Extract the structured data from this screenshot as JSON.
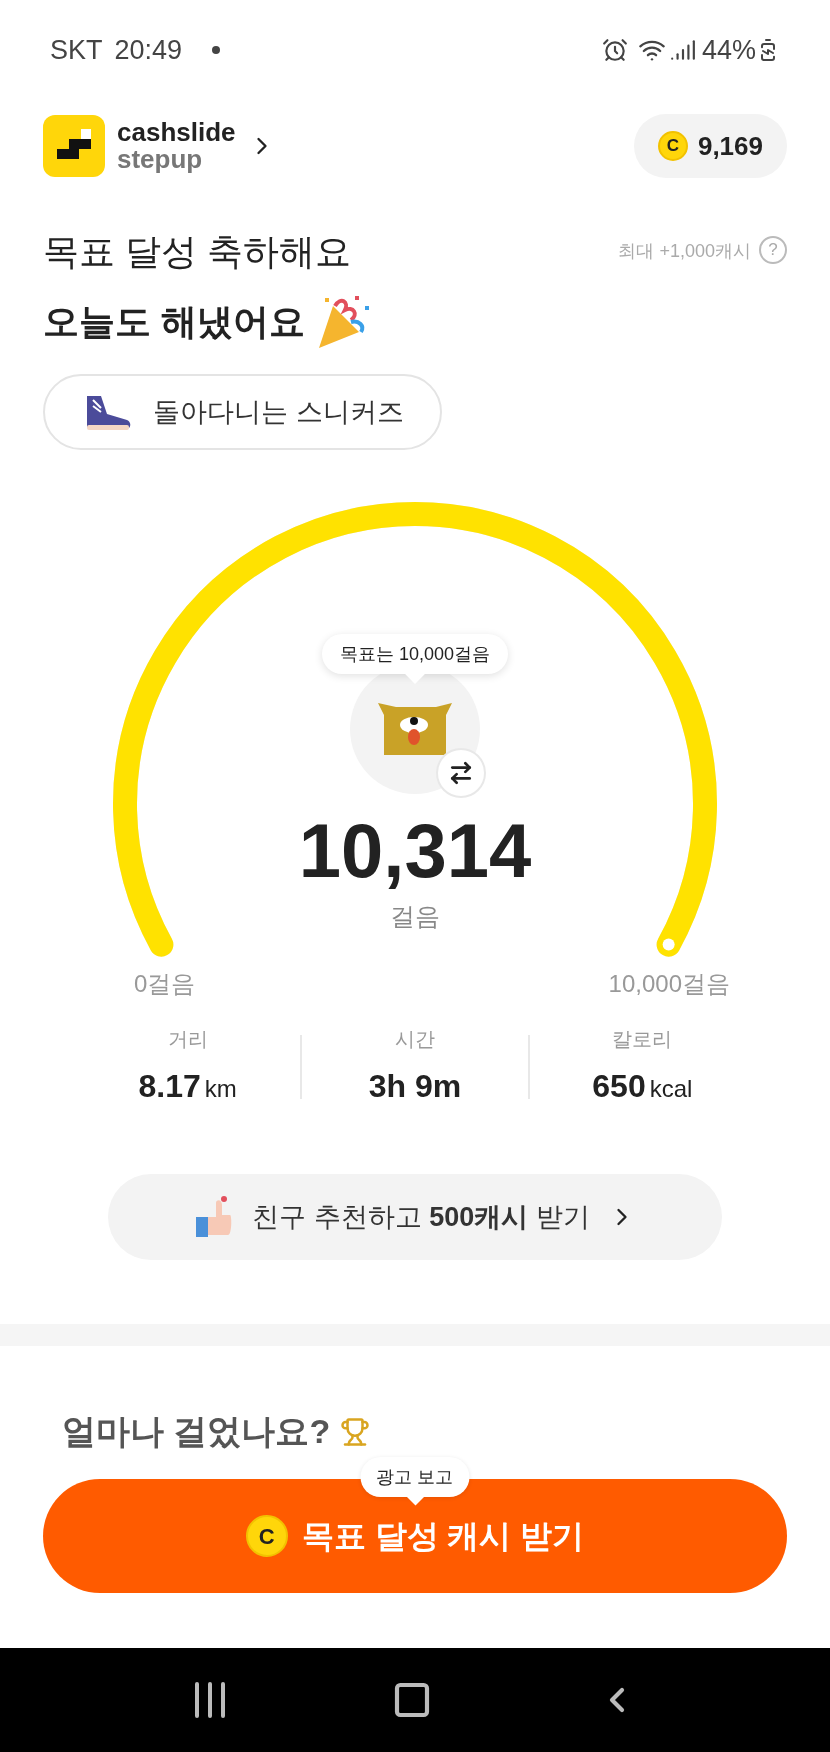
{
  "status_bar": {
    "carrier": "SKT",
    "time": "20:49",
    "battery": "44%"
  },
  "header": {
    "brand_line1": "cashslide",
    "brand_line2": "stepup",
    "coin_symbol": "C",
    "coins": "9,169"
  },
  "greeting": {
    "line1": "목표 달성 축하해요",
    "line2": "오늘도 해냈어요",
    "max_reward": "최대 +1,000캐시",
    "help": "?"
  },
  "badge": {
    "label": "돌아다니는 스니커즈"
  },
  "gauge": {
    "goal_bubble": "목표는 10,000걸음",
    "steps": "10,314",
    "unit": "걸음",
    "min_label": "0걸음",
    "max_label": "10,000걸음"
  },
  "stats": [
    {
      "label": "거리",
      "value": "8.17",
      "unit": "km"
    },
    {
      "label": "시간",
      "value": "3h 9m"
    },
    {
      "label": "칼로리",
      "value": "650",
      "unit": "kcal"
    }
  ],
  "referral": {
    "text": "친구 추천하고 **500캐시** 받기"
  },
  "section_heading": "얼마나 걸었나요?",
  "cta": {
    "tooltip": "광고 보고",
    "coin_symbol": "C",
    "label": "목표 달성 캐시 받기"
  }
}
